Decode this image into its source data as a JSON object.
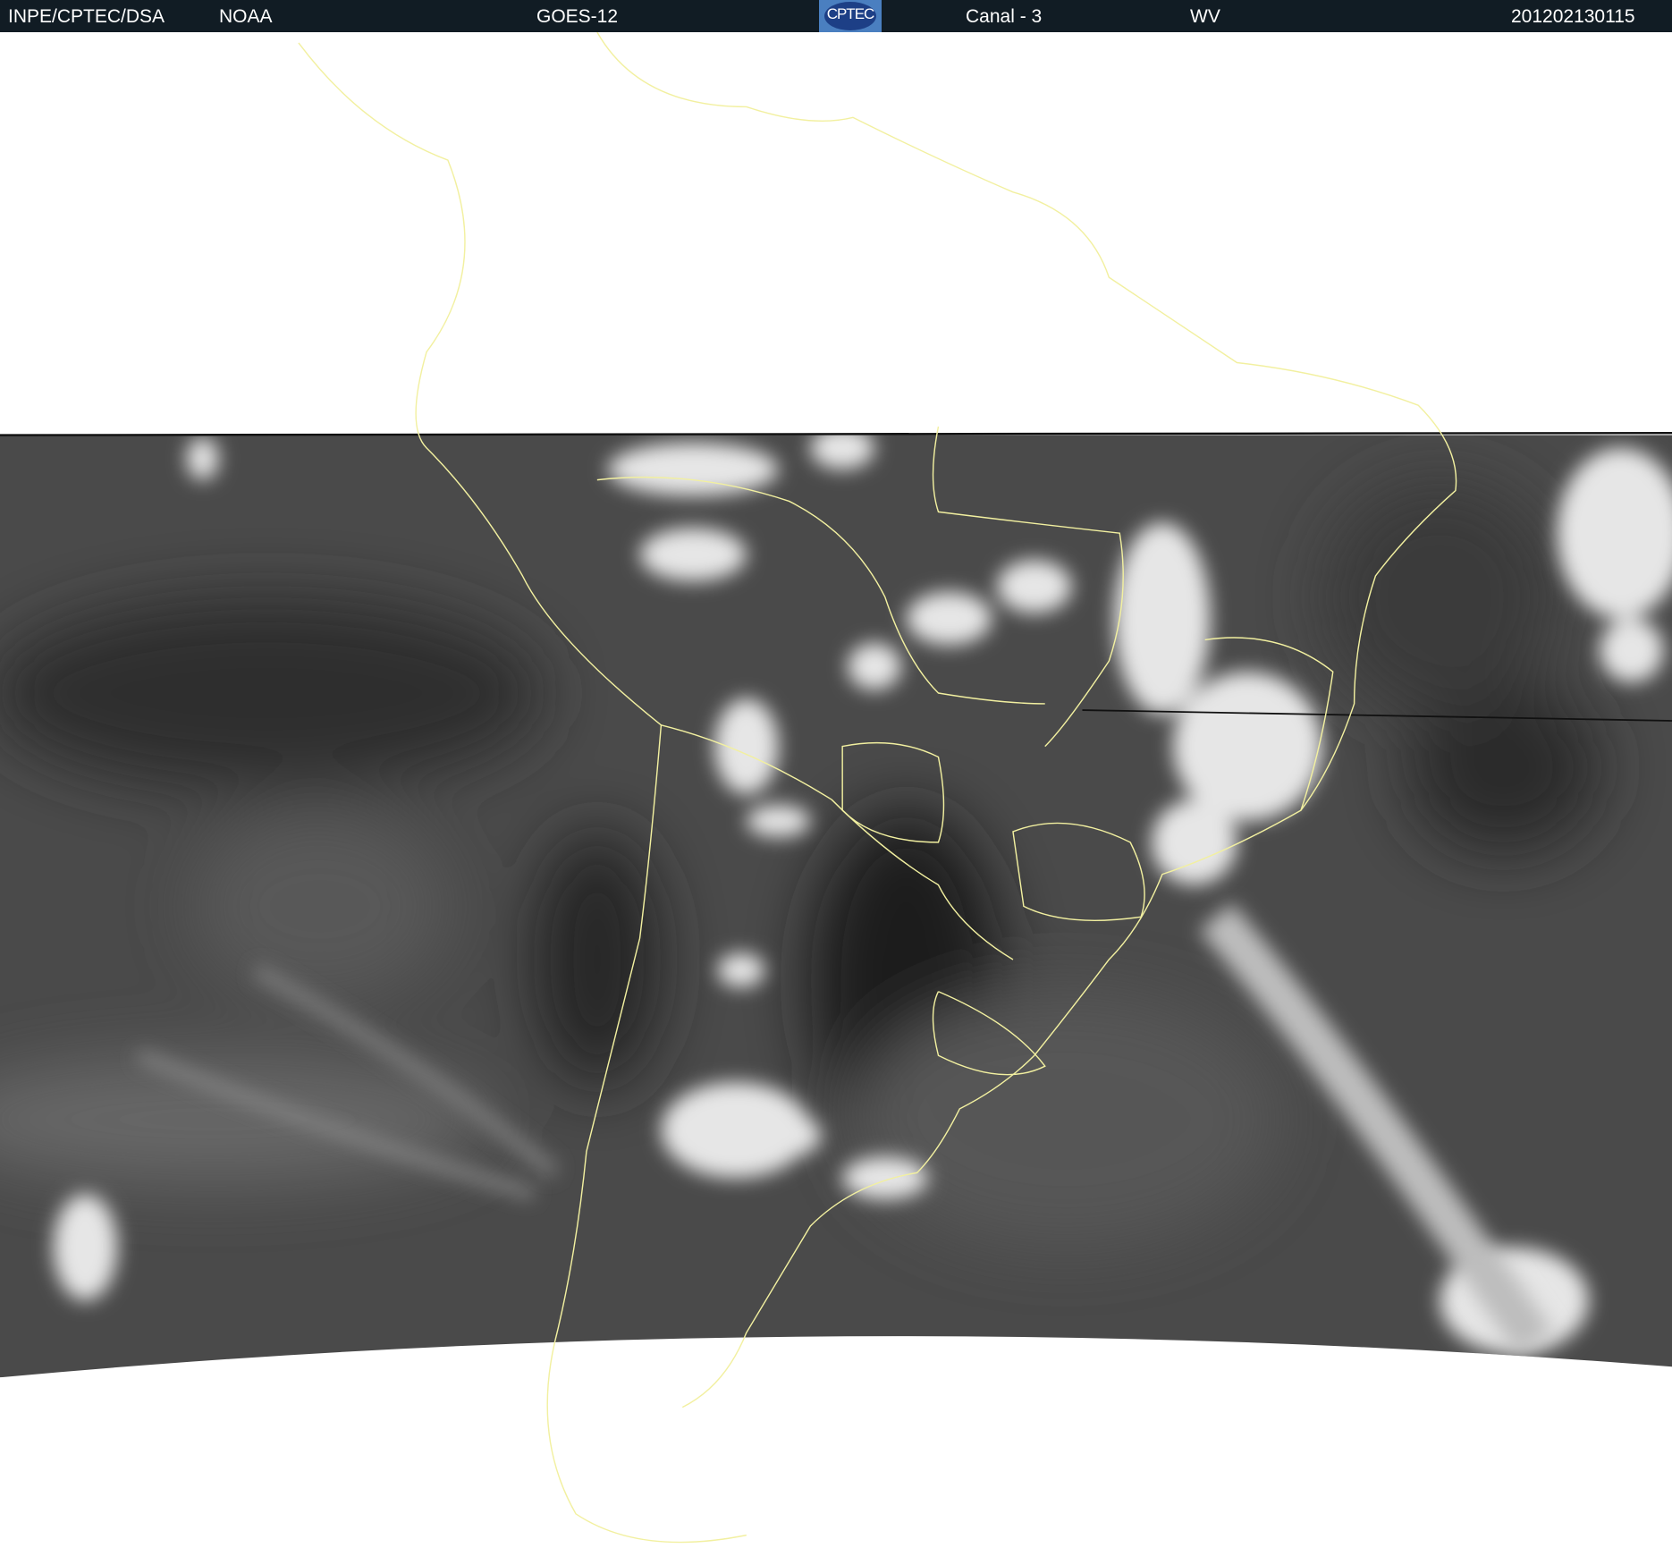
{
  "header": {
    "agency": "INPE/CPTEC/DSA",
    "source": "NOAA",
    "satellite": "GOES-12",
    "logo_text": "CPTEC",
    "channel": "Canal - 3",
    "band": "WV",
    "timestamp": "201202130115"
  },
  "colors": {
    "header_bg": "#111c24",
    "coastline": "#f2f0a0",
    "background": "#ffffff",
    "water_vapor_dark": "#3a3a3a"
  },
  "imagery": {
    "type": "water-vapor satellite image",
    "region": "South America"
  }
}
